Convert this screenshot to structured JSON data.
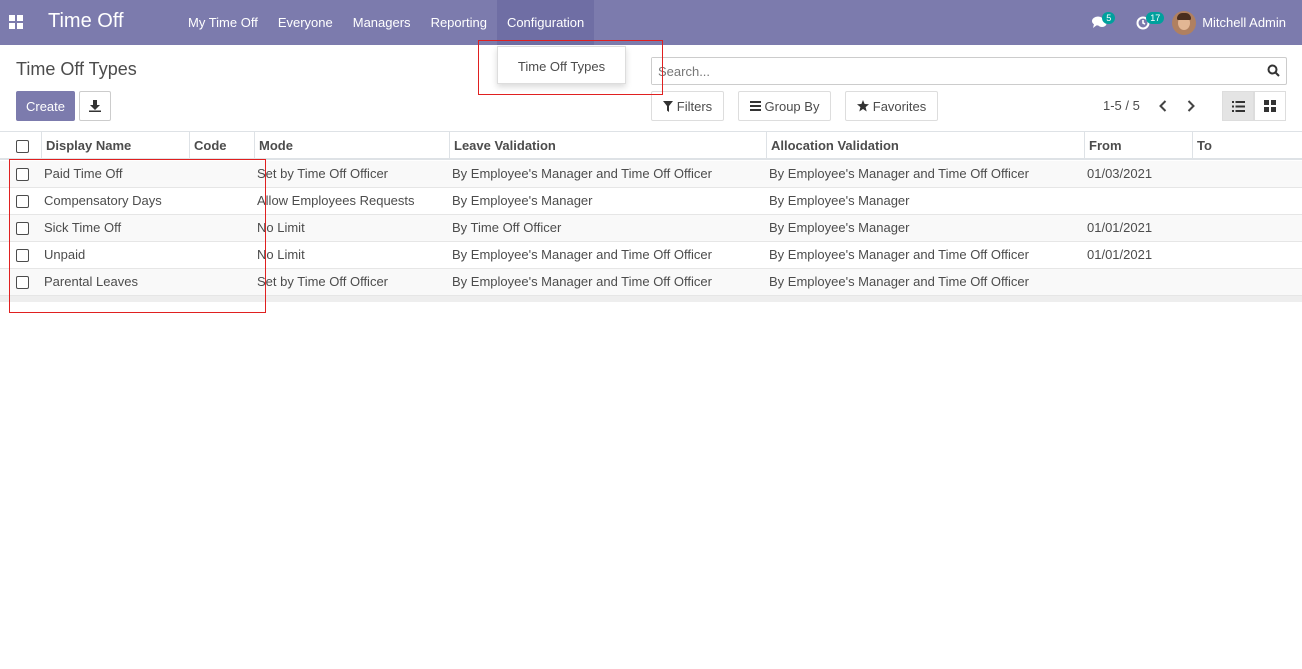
{
  "navbar": {
    "app_title": "Time Off",
    "menu": [
      "My Time Off",
      "Everyone",
      "Managers",
      "Reporting",
      "Configuration"
    ],
    "messages_count": "5",
    "activities_count": "17",
    "user_name": "Mitchell Admin"
  },
  "dropdown": {
    "items": [
      "Time Off Types"
    ]
  },
  "control_panel": {
    "title": "Time Off Types",
    "create_label": "Create",
    "search_placeholder": "Search...",
    "filters_label": "Filters",
    "group_by_label": "Group By",
    "favorites_label": "Favorites",
    "pager": "1-5 / 5"
  },
  "table": {
    "columns": [
      "Display Name",
      "Code",
      "Mode",
      "Leave Validation",
      "Allocation Validation",
      "From",
      "To"
    ],
    "rows": [
      {
        "name": "Paid Time Off",
        "code": "",
        "mode": "Set by Time Off Officer",
        "leave_validation": "By Employee's Manager and Time Off Officer",
        "allocation_validation": "By Employee's Manager and Time Off Officer",
        "from": "01/03/2021",
        "to": ""
      },
      {
        "name": "Compensatory Days",
        "code": "",
        "mode": "Allow Employees Requests",
        "leave_validation": "By Employee's Manager",
        "allocation_validation": "By Employee's Manager",
        "from": "",
        "to": ""
      },
      {
        "name": "Sick Time Off",
        "code": "",
        "mode": "No Limit",
        "leave_validation": "By Time Off Officer",
        "allocation_validation": "By Employee's Manager",
        "from": "01/01/2021",
        "to": ""
      },
      {
        "name": "Unpaid",
        "code": "",
        "mode": "No Limit",
        "leave_validation": "By Employee's Manager and Time Off Officer",
        "allocation_validation": "By Employee's Manager and Time Off Officer",
        "from": "01/01/2021",
        "to": ""
      },
      {
        "name": "Parental Leaves",
        "code": "",
        "mode": "Set by Time Off Officer",
        "leave_validation": "By Employee's Manager and Time Off Officer",
        "allocation_validation": "By Employee's Manager and Time Off Officer",
        "from": "",
        "to": ""
      }
    ]
  },
  "colors": {
    "navbar": "#7c7bad",
    "primary_button": "#7c7bad",
    "highlight": "#e02020"
  },
  "icons": [
    "apps-icon",
    "chat-icon",
    "clock-icon",
    "download-icon",
    "search-icon",
    "filter-icon",
    "list-icon",
    "star-icon",
    "chevron-left-icon",
    "chevron-right-icon",
    "list-view-icon",
    "kanban-view-icon"
  ]
}
